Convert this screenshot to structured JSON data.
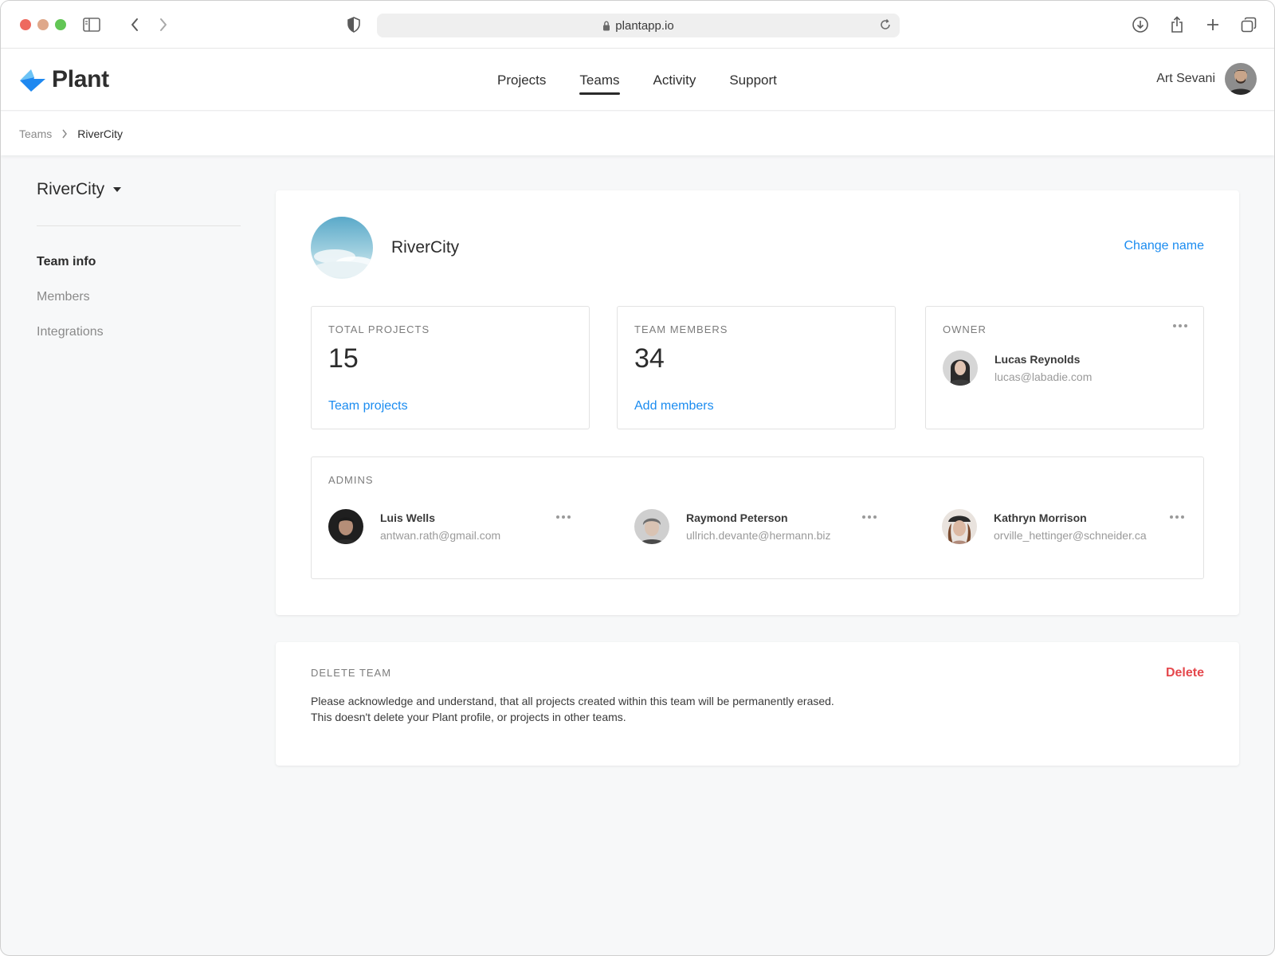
{
  "browser": {
    "url": "plantapp.io",
    "icons": [
      "sidebar-toggle-icon",
      "back-icon",
      "forward-icon",
      "shield-icon",
      "lock-icon",
      "reload-icon",
      "download-icon",
      "share-icon",
      "new-tab-icon",
      "tab-overview-icon"
    ]
  },
  "header": {
    "logo_text": "Plant",
    "nav": [
      "Projects",
      "Teams",
      "Activity",
      "Support"
    ],
    "active_nav": "Teams",
    "user_name": "Art Sevani"
  },
  "breadcrumb": {
    "parent": "Teams",
    "current": "RiverCity"
  },
  "sidebar": {
    "team_name": "RiverCity",
    "items": [
      "Team info",
      "Members",
      "Integrations"
    ],
    "active_item": "Team info"
  },
  "team": {
    "name": "RiverCity",
    "change_name_label": "Change name"
  },
  "stats": {
    "total_projects": {
      "label": "TOTAL PROJECTS",
      "value": "15",
      "link": "Team projects"
    },
    "team_members": {
      "label": "TEAM MEMBERS",
      "value": "34",
      "link": "Add members"
    },
    "owner": {
      "label": "OWNER",
      "name": "Lucas Reynolds",
      "email": "lucas@labadie.com"
    }
  },
  "admins": {
    "label": "ADMINS",
    "people": [
      {
        "name": "Luis Wells",
        "email": "antwan.rath@gmail.com"
      },
      {
        "name": "Raymond Peterson",
        "email": "ullrich.devante@hermann.biz"
      },
      {
        "name": "Kathryn Morrison",
        "email": "orville_hettinger@schneider.ca"
      }
    ]
  },
  "delete_team": {
    "label": "DELETE TEAM",
    "button": "Delete",
    "line1": "Please acknowledge and understand, that all projects created within this team will be permanently erased.",
    "line2": "This doesn't delete your Plant profile, or projects in other teams."
  },
  "colors": {
    "accent": "#1b8cf0",
    "danger": "#e5484d",
    "logo_blue": "#1e88f0",
    "logo_light": "#6cc3f5"
  }
}
